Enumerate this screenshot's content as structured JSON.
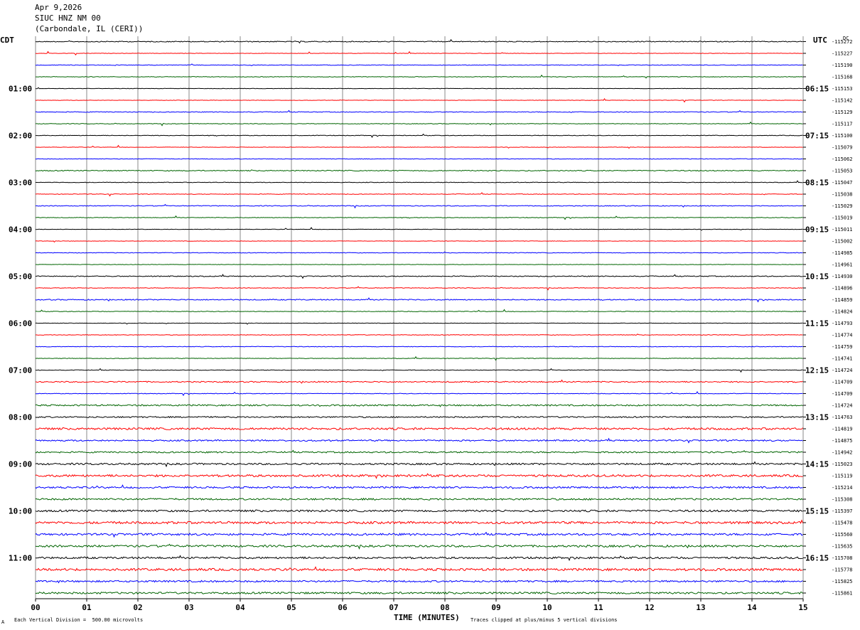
{
  "header": {
    "date": "Apr 9,2026",
    "station": "SIUC HNZ NM 00",
    "location": "(Carbondale, IL (CERI))"
  },
  "left_zone": "CDT",
  "right_zone": "UTC",
  "dc_label": "DC",
  "xaxis_title": "TIME (MINUTES)",
  "footer_left": "Each Vertical Division =  500.00 microvolts",
  "footer_right": "Traces clipped at plus/minus 5 vertical divisions",
  "footer_mark": "A",
  "colors": {
    "trace_cycle": [
      "#000000",
      "#ff0000",
      "#0000ff",
      "#006400"
    ],
    "grid": "#888888"
  },
  "chart_data": {
    "type": "line",
    "title": "SIUC HNZ NM 00",
    "xlabel": "TIME (MINUTES)",
    "xlim": [
      0,
      15
    ],
    "x_ticks": [
      "00",
      "01",
      "02",
      "03",
      "04",
      "05",
      "06",
      "07",
      "08",
      "09",
      "10",
      "11",
      "12",
      "13",
      "14",
      "15"
    ],
    "rows_per_hour": 4,
    "left_hour_labels": [
      "01:00",
      "02:00",
      "03:00",
      "04:00",
      "05:00",
      "06:00",
      "07:00",
      "08:00",
      "09:00",
      "10:00",
      "11:00"
    ],
    "right_hour_labels": [
      "06:15",
      "07:15",
      "08:15",
      "09:15",
      "10:15",
      "11:15",
      "12:15",
      "13:15",
      "14:15",
      "15:15",
      "16:15"
    ],
    "dc_offsets": [
      "-115272",
      "-115227",
      "-115190",
      "-115168",
      "-115153",
      "-115142",
      "-115129",
      "-115117",
      "-115100",
      "-115079",
      "-115062",
      "-115053",
      "-115047",
      "-115038",
      "-115029",
      "-115019",
      "-115011",
      "-115002",
      "-114985",
      "-114961",
      "-114930",
      "-114896",
      "-114859",
      "-114824",
      "-114793",
      "-114774",
      "-114759",
      "-114741",
      "-114724",
      "-114709",
      "-114709",
      "-114724",
      "-114763",
      "-114819",
      "-114875",
      "-114942",
      "-115023",
      "-115119",
      "-115214",
      "-115308",
      "-115397",
      "-115478",
      "-115560",
      "-115635",
      "-115708",
      "-115778",
      "-115825",
      "-115861"
    ],
    "noise_level": [
      0.6,
      0.3,
      0.4,
      0.4,
      0.3,
      0.3,
      0.5,
      0.4,
      0.4,
      0.3,
      0.4,
      0.6,
      0.4,
      0.4,
      0.5,
      0.4,
      0.3,
      0.3,
      0.4,
      0.3,
      0.6,
      0.4,
      0.7,
      0.4,
      0.3,
      0.4,
      0.4,
      0.4,
      0.4,
      0.8,
      0.4,
      1.0,
      0.9,
      1.4,
      1.0,
      1.0,
      1.2,
      1.5,
      1.2,
      1.2,
      1.3,
      1.6,
      1.4,
      1.4,
      1.3,
      1.6,
      1.2,
      1.3
    ]
  }
}
